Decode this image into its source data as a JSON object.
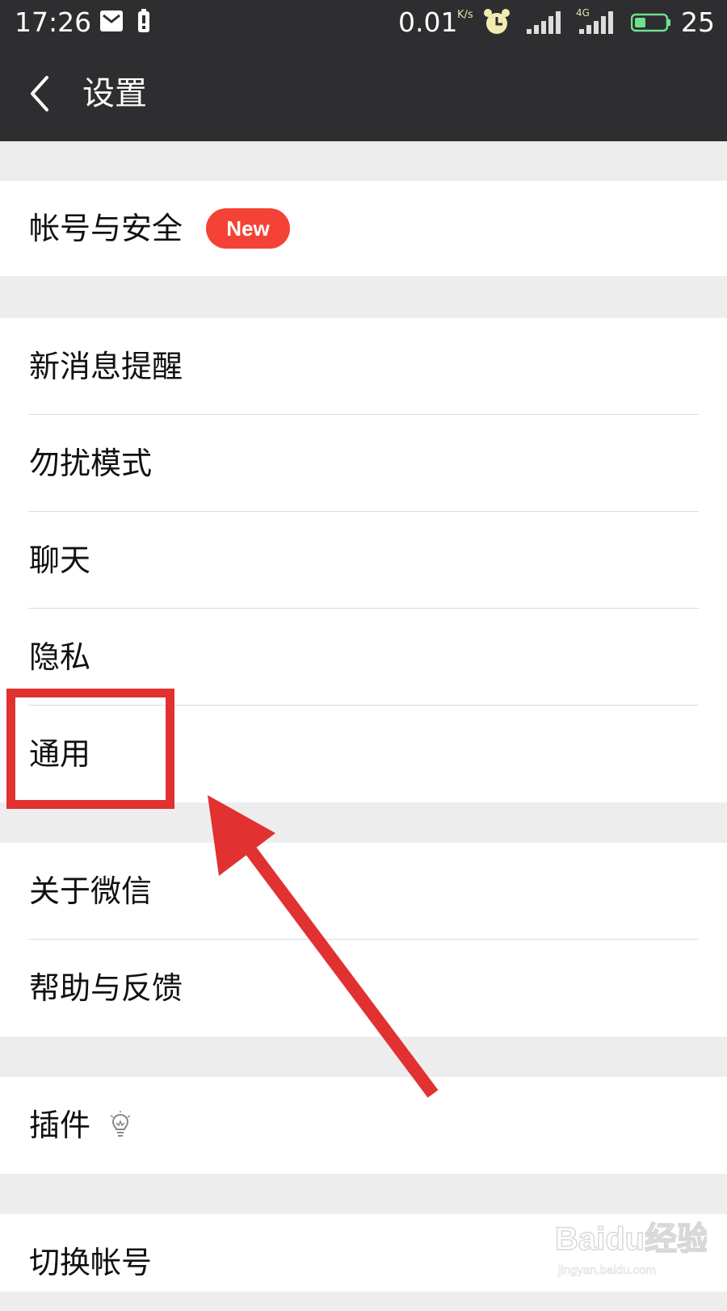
{
  "status_bar": {
    "time": "17:26",
    "network_speed": "0.01",
    "speed_unit": "K/s",
    "network_type": "4G",
    "battery_percent": "25"
  },
  "nav": {
    "title": "设置"
  },
  "settings": {
    "account_security": "帐号与安全",
    "new_badge": "New",
    "new_message_alerts": "新消息提醒",
    "do_not_disturb": "勿扰模式",
    "chat": "聊天",
    "privacy": "隐私",
    "general": "通用",
    "about_wechat": "关于微信",
    "help_feedback": "帮助与反馈",
    "plugins": "插件",
    "switch_account": "切换帐号"
  },
  "icons": {
    "back": "chevron-left-icon",
    "plugins_hint": "lightbulb-icon"
  },
  "colors": {
    "header_bg": "#2e2d30",
    "page_bg": "#ededed",
    "badge_red": "#f44336",
    "annotation_red": "#e13131"
  },
  "watermark": {
    "text": "Baidu经验",
    "url": "jingyan.baidu.com"
  }
}
